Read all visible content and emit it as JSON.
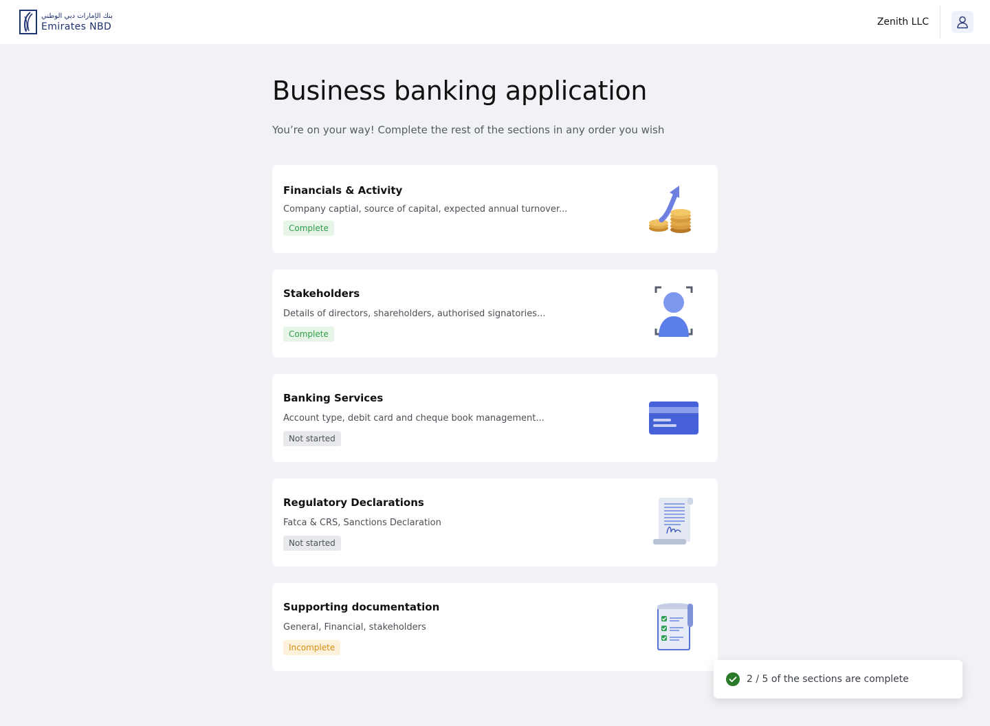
{
  "header": {
    "brand_arabic": "بنك الإمارات دبي الوطني",
    "brand_name": "Emirates NBD",
    "company": "Zenith LLC",
    "logo_icon": "emirates-nbd-logo",
    "user_icon": "user-icon"
  },
  "page": {
    "title": "Business banking application",
    "subtitle": "You’re on your way! Complete the rest of the sections in any order you wish"
  },
  "sections": [
    {
      "title": "Financials & Activity",
      "description": "Company captial, source of capital, expected annual turnover...",
      "status": "Complete",
      "icon": "coins-growth-icon"
    },
    {
      "title": "Stakeholders",
      "description": "Details of directors, shareholders, authorised signatories...",
      "status": "Complete",
      "icon": "person-scan-icon"
    },
    {
      "title": "Banking Services",
      "description": "Account type, debit card and cheque book management...",
      "status": "Not started",
      "icon": "bank-card-icon"
    },
    {
      "title": "Regulatory Declarations",
      "description": "Fatca & CRS, Sanctions Declaration",
      "status": "Not started",
      "icon": "signed-document-icon"
    },
    {
      "title": "Supporting documentation",
      "description": "General, Financial, stakeholders",
      "status": "Incomplete",
      "icon": "checklist-document-icon"
    }
  ],
  "toast": {
    "text": "2 / 5 of the sections are complete",
    "icon": "check-circle-icon"
  },
  "colors": {
    "brand": "#1c2f6e",
    "background": "#f1f2f5",
    "complete": "#2e9e47",
    "incomplete": "#d48f10",
    "toast_check": "#2a7a2a"
  }
}
